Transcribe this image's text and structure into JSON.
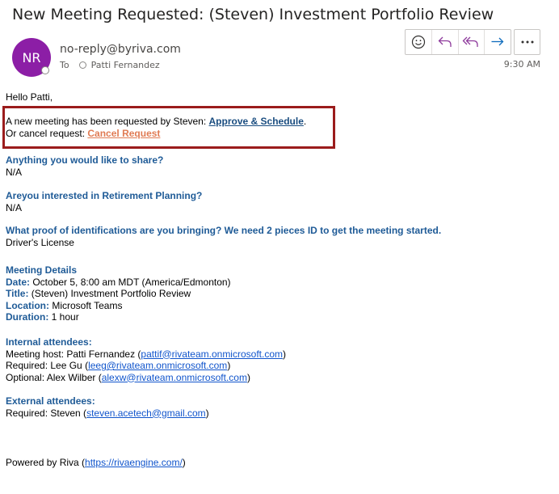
{
  "email": {
    "subject": "New Meeting Requested: (Steven) Investment Portfolio Review",
    "avatar_initials": "NR",
    "avatar_color": "#8c1ea6",
    "sender": "no-reply@byriva.com",
    "to_label": "To",
    "to_name": "Patti Fernandez",
    "time": "9:30 AM",
    "toolbar_icons": [
      "emoji-icon",
      "reply-icon",
      "reply-all-icon",
      "forward-icon",
      "more-icon"
    ]
  },
  "body": {
    "greeting": "Hello Patti,",
    "request_text": "A new meeting has been requested by Steven: ",
    "approve_link": "Approve & Schedule",
    "period": ".",
    "cancel_text": "Or cancel request: ",
    "cancel_link": "Cancel Request",
    "questions": [
      {
        "q": "Anything you would like to share?",
        "a": "N/A"
      },
      {
        "q": "Areyou interested in Retirement Planning?",
        "a": "N/A"
      },
      {
        "q": "What proof of identifications are you bringing? We need 2 pieces ID to get the meeting started.",
        "a": "Driver's License"
      }
    ],
    "details": {
      "title": "Meeting Details",
      "date_label": "Date:",
      "date_value": " October 5, 8:00 am MDT (America/Edmonton)",
      "title_label": "Title:",
      "title_value": " (Steven) Investment Portfolio Review",
      "location_label": "Location:",
      "location_value": " Microsoft Teams",
      "duration_label": "Duration:",
      "duration_value": " 1 hour"
    },
    "internal": {
      "title": "Internal attendees:",
      "rows": [
        {
          "prefix": "Meeting host: Patti Fernandez (",
          "email": "pattif@rivateam.onmicrosoft.com",
          "suffix": ")"
        },
        {
          "prefix": "Required: Lee Gu (",
          "email": "leeg@rivateam.onmicrosoft.com",
          "suffix": ")"
        },
        {
          "prefix": "Optional: Alex Wilber (",
          "email": "alexw@rivateam.onmicrosoft.com",
          "suffix": ")"
        }
      ]
    },
    "external": {
      "title": "External attendees:",
      "prefix": "Required: Steven (",
      "email": "steven.acetech@gmail.com",
      "suffix": ")"
    },
    "footer": {
      "prefix": "Powered by Riva (",
      "link": "https://rivaengine.com/",
      "suffix": ")"
    }
  }
}
